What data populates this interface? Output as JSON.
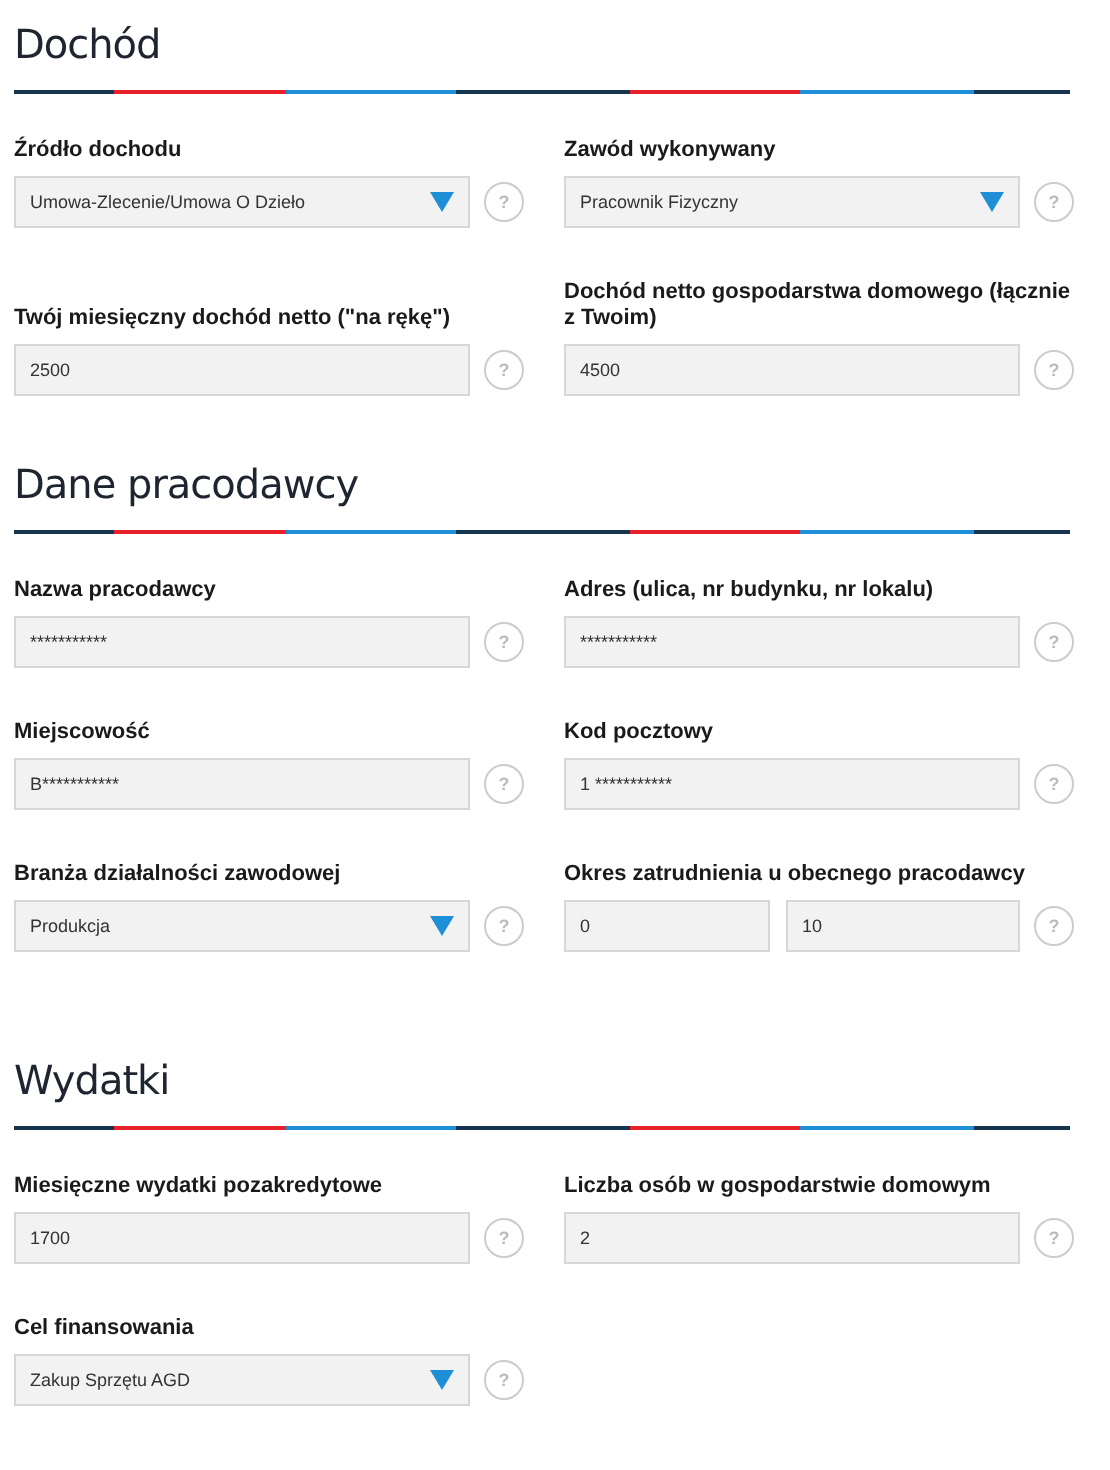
{
  "sections": [
    {
      "title": "Dochód",
      "rows": [
        [
          {
            "label": "Źródło dochodu",
            "kind": "select",
            "value": "Umowa-Zlecenie/Umowa O Dzieło",
            "help": "?"
          },
          {
            "label": "Zawód wykonywany",
            "kind": "select",
            "value": "Pracownik Fizyczny",
            "help": "?"
          }
        ],
        [
          {
            "label": "Twój miesięczny dochód netto (\"na rękę\")",
            "kind": "text",
            "value": "2500",
            "help": "?"
          },
          {
            "label": "Dochód netto gospodarstwa domowego (łącznie z Twoim)",
            "kind": "text",
            "value": "4500",
            "help": "?"
          }
        ]
      ]
    },
    {
      "title": "Dane pracodawcy",
      "rows": [
        [
          {
            "label": "Nazwa pracodawcy",
            "kind": "text",
            "value": "***********",
            "help": "?"
          },
          {
            "label": "Adres (ulica, nr budynku, nr lokalu)",
            "kind": "text",
            "value": "***********",
            "help": "?"
          }
        ],
        [
          {
            "label": "Miejscowość",
            "kind": "text",
            "value": "B***********",
            "help": "?"
          },
          {
            "label": "Kod pocztowy",
            "kind": "text",
            "value": "1 ***********",
            "help": "?"
          }
        ],
        [
          {
            "label": "Branża działalności zawodowej",
            "kind": "select",
            "value": "Produkcja",
            "help": "?"
          },
          {
            "label": "Okres zatrudnienia u obecnego pracodawcy",
            "kind": "pair",
            "values": [
              "0",
              "10"
            ],
            "help": "?"
          }
        ]
      ]
    },
    {
      "title": "Wydatki",
      "rows": [
        [
          {
            "label": "Miesięczne wydatki pozakredytowe",
            "kind": "text",
            "value": "1700",
            "help": "?"
          },
          {
            "label": "Liczba osób w gospodarstwie domowym",
            "kind": "text",
            "value": "2",
            "help": "?"
          }
        ],
        [
          {
            "label": "Cel finansowania",
            "kind": "select",
            "value": "Zakup Sprzętu AGD",
            "help": "?"
          }
        ]
      ]
    }
  ]
}
